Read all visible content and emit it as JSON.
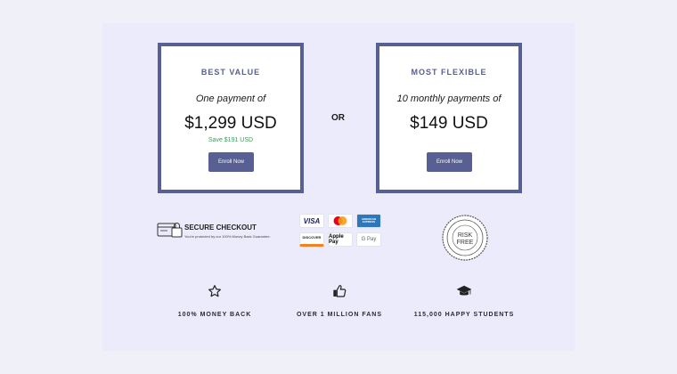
{
  "plans": [
    {
      "tag": "BEST VALUE",
      "lead": "One payment of",
      "price": "$1,299 USD",
      "save": "Save $191 USD",
      "button": "Enroll Now"
    },
    {
      "tag": "MOST FLEXIBLE",
      "lead": "10 monthly payments of",
      "price": "$149 USD",
      "save": "",
      "button": "Enroll Now"
    }
  ],
  "or_label": "OR",
  "secure": {
    "title": "SECURE CHECKOUT",
    "subtitle": "You're protected by our 100% Money Back Guarantee."
  },
  "payments": [
    "VISA",
    "mastercard",
    "AMERICAN EXPRESS",
    "DISCOVER",
    "Apple Pay",
    "G Pay"
  ],
  "badge": {
    "line1": "RISK",
    "line2": "FREE",
    "ring_top": "100% SATISFACTION",
    "ring_bottom": "GUARANTEE"
  },
  "features": [
    {
      "icon": "star-icon",
      "label": "100% MONEY BACK"
    },
    {
      "icon": "thumbs-up-icon",
      "label": "OVER 1 MILLION FANS"
    },
    {
      "icon": "graduation-cap-icon",
      "label": "115,000 HAPPY STUDENTS"
    }
  ],
  "colors": {
    "accent": "#585f92",
    "save": "#3d9a5a",
    "background": "#eff0f8"
  }
}
